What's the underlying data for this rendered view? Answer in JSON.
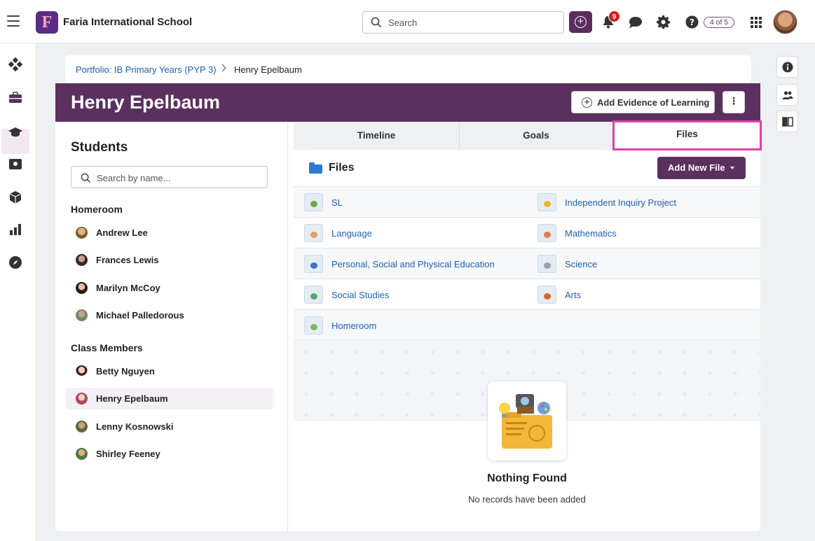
{
  "topbar": {
    "school_name": "Faria International School",
    "logo_letter": "F",
    "search_placeholder": "Search",
    "notification_count": "9",
    "pager": "4 of 5"
  },
  "breadcrumb": {
    "parent": "Portfolio: IB Primary Years (PYP 3)",
    "separator": ">",
    "current": "Henry Epelbaum"
  },
  "header": {
    "title": "Henry Epelbaum",
    "add_evidence_label": "Add Evidence of Learning",
    "more_label": "⋮"
  },
  "students_panel": {
    "title": "Students",
    "search_placeholder": "Search by name...",
    "groups": [
      {
        "name": "Homeroom",
        "students": [
          "Andrew Lee",
          "Frances Lewis",
          "Marilyn McCoy",
          "Michael Palledorous"
        ]
      },
      {
        "name": "Class Members",
        "students": [
          "Betty Nguyen",
          "Henry Epelbaum",
          "Lenny Kosnowski",
          "Shirley Feeney"
        ]
      }
    ],
    "selected_student": "Henry Epelbaum"
  },
  "tabs": [
    {
      "label": "Timeline"
    },
    {
      "label": "Goals"
    },
    {
      "label": "Files"
    }
  ],
  "selected_tab": "Files",
  "files": {
    "heading": "Files",
    "add_new_label": "Add New File",
    "folders": [
      [
        "SL",
        "Independent Inquiry Project"
      ],
      [
        "Language",
        "Mathematics"
      ],
      [
        "Personal, Social and Physical Education",
        "Science"
      ],
      [
        "Social Studies",
        "Arts"
      ],
      [
        "Homeroom",
        ""
      ]
    ]
  },
  "empty_state": {
    "title": "Nothing Found",
    "subtitle": "No records have been added"
  },
  "colors": {
    "brand_purple": "#5b305e",
    "link_blue": "#1f5fb0",
    "highlight_pink": "#e040a8",
    "badge_red": "#d32020"
  }
}
